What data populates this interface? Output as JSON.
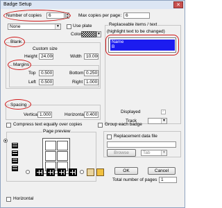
{
  "window": {
    "title": "Badge Setup",
    "close_glyph": "✕"
  },
  "copies": {
    "label": "Number of copies",
    "value": "6",
    "max_label": "Max copies per page:",
    "max_value": "6"
  },
  "template": {
    "value": "None",
    "use_plate_label": "Use plate",
    "color_label": "Color:"
  },
  "blank": {
    "title": "Blank",
    "custom_size_label": "Custom size",
    "height_label": "Height",
    "height_value": "24.000",
    "width_label": "Width",
    "width_value": "10.000"
  },
  "margins": {
    "title": "Margins",
    "top_label": "Top",
    "top_value": "0.500",
    "bottom_label": "Bottom",
    "bottom_value": "0.250",
    "left_label": "Left",
    "left_value": "0.500",
    "right_label": "Right",
    "right_value": "1.000"
  },
  "spacing": {
    "title": "Spacing",
    "vertical_label": "Vertical",
    "vertical_value": "1.000",
    "horizontal_label": "Horizontal",
    "horizontal_value": "0.400"
  },
  "replaceable": {
    "title": "Replaceable items / text",
    "subtitle": "(highlight text to be changed)",
    "items": [
      "Name",
      "B"
    ],
    "displayed_label": "Displayed",
    "track_label": "Track"
  },
  "options": {
    "compress_label": "Compress text equally over copies",
    "group_label": "Group each badge",
    "replacement_label": "Replacement data file",
    "browse_label": "Browse",
    "tab_value": "Tab"
  },
  "preview": {
    "title": "Page preview",
    "horizontal_label": "Horizontal"
  },
  "footer": {
    "ok_label": "OK",
    "cancel_label": "Cancel",
    "total_pages_label": "Total number of pages",
    "total_pages_value": "1"
  }
}
